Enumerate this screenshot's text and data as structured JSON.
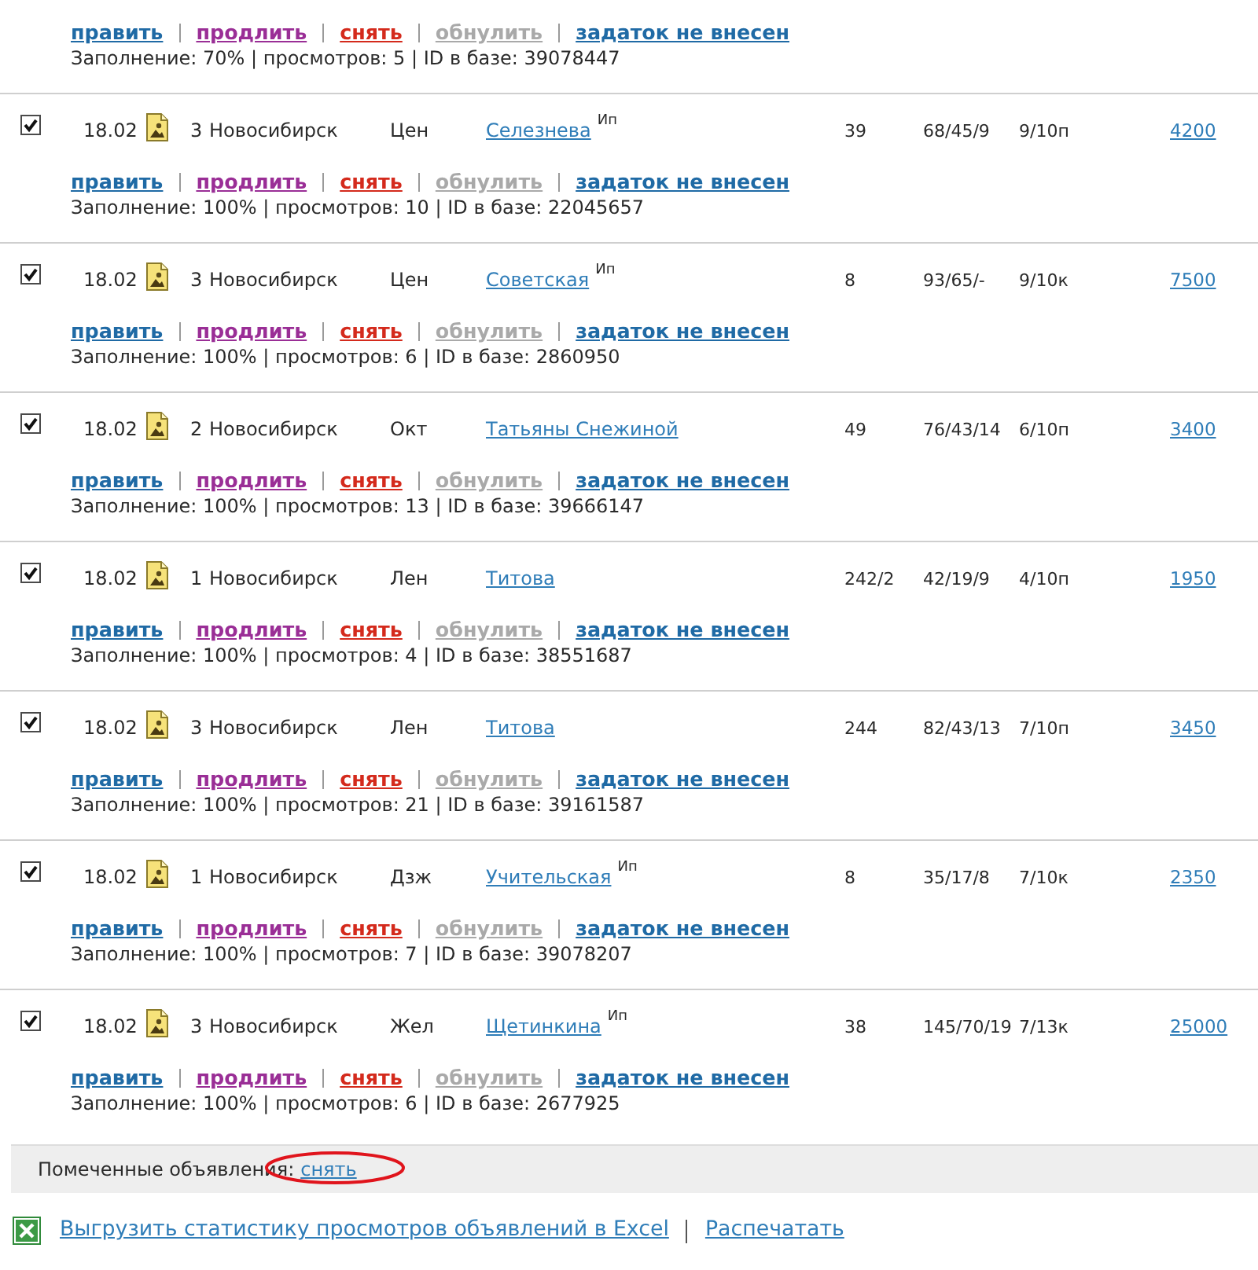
{
  "top_partial": {
    "actions": [
      {
        "label": "править",
        "kind": "edit",
        "disabled": false
      },
      {
        "label": "продлить",
        "kind": "extend",
        "disabled": false
      },
      {
        "label": "снять",
        "kind": "remove",
        "disabled": false
      },
      {
        "label": "обнулить",
        "kind": "reset",
        "disabled": true
      },
      {
        "label": "задаток не внесен",
        "kind": "deposit",
        "disabled": false
      }
    ],
    "info": "Заполнение: 70% | просмотров: 5 | ID в базе: 39078447"
  },
  "listings": [
    {
      "checked": true,
      "date": "18.02",
      "rooms": "3",
      "city": "Новосибирск",
      "district": "Цен",
      "street": "Селезнева",
      "street_note": "Ип",
      "house": "39",
      "area": "68/45/9",
      "floor": "9/10п",
      "price": "4200",
      "actions": [
        {
          "label": "править",
          "kind": "edit",
          "disabled": false
        },
        {
          "label": "продлить",
          "kind": "extend",
          "disabled": false
        },
        {
          "label": "снять",
          "kind": "remove",
          "disabled": false
        },
        {
          "label": "обнулить",
          "kind": "reset",
          "disabled": true
        },
        {
          "label": "задаток не внесен",
          "kind": "deposit",
          "disabled": false
        }
      ],
      "info": "Заполнение: 100% | просмотров: 10 | ID в базе: 22045657"
    },
    {
      "checked": true,
      "date": "18.02",
      "rooms": "3",
      "city": "Новосибирск",
      "district": "Цен",
      "street": "Советская",
      "street_note": "Ип",
      "house": "8",
      "area": "93/65/-",
      "floor": "9/10к",
      "price": "7500",
      "actions": [
        {
          "label": "править",
          "kind": "edit",
          "disabled": false
        },
        {
          "label": "продлить",
          "kind": "extend",
          "disabled": false
        },
        {
          "label": "снять",
          "kind": "remove",
          "disabled": false
        },
        {
          "label": "обнулить",
          "kind": "reset",
          "disabled": true
        },
        {
          "label": "задаток не внесен",
          "kind": "deposit",
          "disabled": false
        }
      ],
      "info": "Заполнение: 100% | просмотров: 6 | ID в базе: 2860950"
    },
    {
      "checked": true,
      "date": "18.02",
      "rooms": "2",
      "city": "Новосибирск",
      "district": "Окт",
      "street": "Татьяны Снежиной",
      "house": "49",
      "area": "76/43/14",
      "floor": "6/10п",
      "price": "3400",
      "actions": [
        {
          "label": "править",
          "kind": "edit",
          "disabled": false
        },
        {
          "label": "продлить",
          "kind": "extend",
          "disabled": false
        },
        {
          "label": "снять",
          "kind": "remove",
          "disabled": false
        },
        {
          "label": "обнулить",
          "kind": "reset",
          "disabled": true
        },
        {
          "label": "задаток не внесен",
          "kind": "deposit",
          "disabled": false
        }
      ],
      "info": "Заполнение: 100% | просмотров: 13 | ID в базе: 39666147"
    },
    {
      "checked": true,
      "date": "18.02",
      "rooms": "1",
      "city": "Новосибирск",
      "district": "Лен",
      "street": "Титова",
      "house": "242/2",
      "area": "42/19/9",
      "floor": "4/10п",
      "price": "1950",
      "actions": [
        {
          "label": "править",
          "kind": "edit",
          "disabled": false
        },
        {
          "label": "продлить",
          "kind": "extend",
          "disabled": false
        },
        {
          "label": "снять",
          "kind": "remove",
          "disabled": false
        },
        {
          "label": "обнулить",
          "kind": "reset",
          "disabled": true
        },
        {
          "label": "задаток не внесен",
          "kind": "deposit",
          "disabled": false
        }
      ],
      "info": "Заполнение: 100% | просмотров: 4 | ID в базе: 38551687"
    },
    {
      "checked": true,
      "date": "18.02",
      "rooms": "3",
      "city": "Новосибирск",
      "district": "Лен",
      "street": "Титова",
      "house": "244",
      "area": "82/43/13",
      "floor": "7/10п",
      "price": "3450",
      "actions": [
        {
          "label": "править",
          "kind": "edit",
          "disabled": false
        },
        {
          "label": "продлить",
          "kind": "extend",
          "disabled": false
        },
        {
          "label": "снять",
          "kind": "remove",
          "disabled": false
        },
        {
          "label": "обнулить",
          "kind": "reset",
          "disabled": true
        },
        {
          "label": "задаток не внесен",
          "kind": "deposit",
          "disabled": false
        }
      ],
      "info": "Заполнение: 100% | просмотров: 21 | ID в базе: 39161587"
    },
    {
      "checked": true,
      "date": "18.02",
      "rooms": "1",
      "city": "Новосибирск",
      "district": "Дзж",
      "street": "Учительская",
      "street_note": "Ип",
      "house": "8",
      "area": "35/17/8",
      "floor": "7/10к",
      "price": "2350",
      "actions": [
        {
          "label": "править",
          "kind": "edit",
          "disabled": false
        },
        {
          "label": "продлить",
          "kind": "extend",
          "disabled": false
        },
        {
          "label": "снять",
          "kind": "remove",
          "disabled": false
        },
        {
          "label": "обнулить",
          "kind": "reset",
          "disabled": true
        },
        {
          "label": "задаток не внесен",
          "kind": "deposit",
          "disabled": false
        }
      ],
      "info": "Заполнение: 100% | просмотров: 7 | ID в базе: 39078207"
    },
    {
      "checked": true,
      "date": "18.02",
      "rooms": "3",
      "city": "Новосибирск",
      "district": "Жел",
      "street": "Щетинкина",
      "street_note": "Ип",
      "house": "38",
      "area": "145/70/19",
      "floor": "7/13к",
      "price": "25000",
      "actions": [
        {
          "label": "править",
          "kind": "edit",
          "disabled": false
        },
        {
          "label": "продлить",
          "kind": "extend",
          "disabled": false
        },
        {
          "label": "снять",
          "kind": "remove",
          "disabled": false
        },
        {
          "label": "обнулить",
          "kind": "reset",
          "disabled": true
        },
        {
          "label": "задаток не внесен",
          "kind": "deposit",
          "disabled": false
        }
      ],
      "info": "Заполнение: 100% | просмотров: 6 | ID в базе: 2677925"
    }
  ],
  "marked_bar": {
    "label": "Помеченные объявления:",
    "link": "снять",
    "highlighted": true
  },
  "footer_links": [
    {
      "label": "Выгрузить статистику просмотров объявлений в Excel",
      "kind": "excel"
    },
    {
      "label": "Распечатать",
      "kind": "print"
    }
  ]
}
